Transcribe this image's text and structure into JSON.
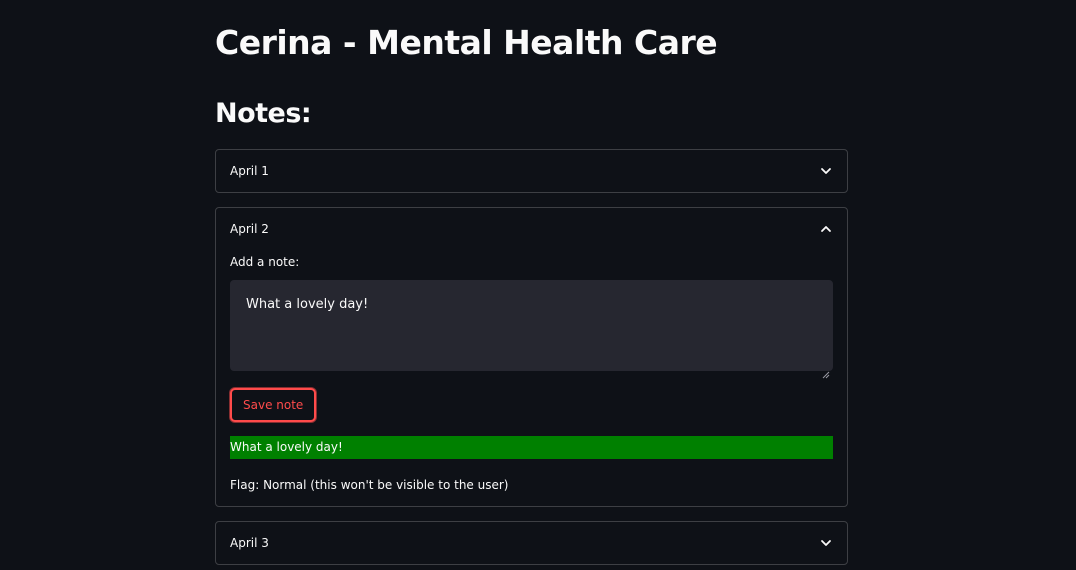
{
  "header": {
    "title": "Cerina - Mental Health Care"
  },
  "notes": {
    "heading": "Notes:",
    "expanders": [
      {
        "label": "April 1",
        "expanded": false,
        "icon": "chevron-down-icon"
      },
      {
        "label": "April 2",
        "expanded": true,
        "icon": "chevron-up-icon",
        "field_label": "Add a note:",
        "note_value": "What a lovely day!",
        "save_label": "Save note",
        "saved_message": "What a lovely day!",
        "flag_text": "Flag: Normal (this won't be visible to the user)"
      },
      {
        "label": "April 3",
        "expanded": false,
        "icon": "chevron-down-icon"
      }
    ]
  },
  "colors": {
    "background": "#0e1117",
    "accent": "#ff4b4b",
    "success": "#008000",
    "input_bg": "#262730"
  }
}
